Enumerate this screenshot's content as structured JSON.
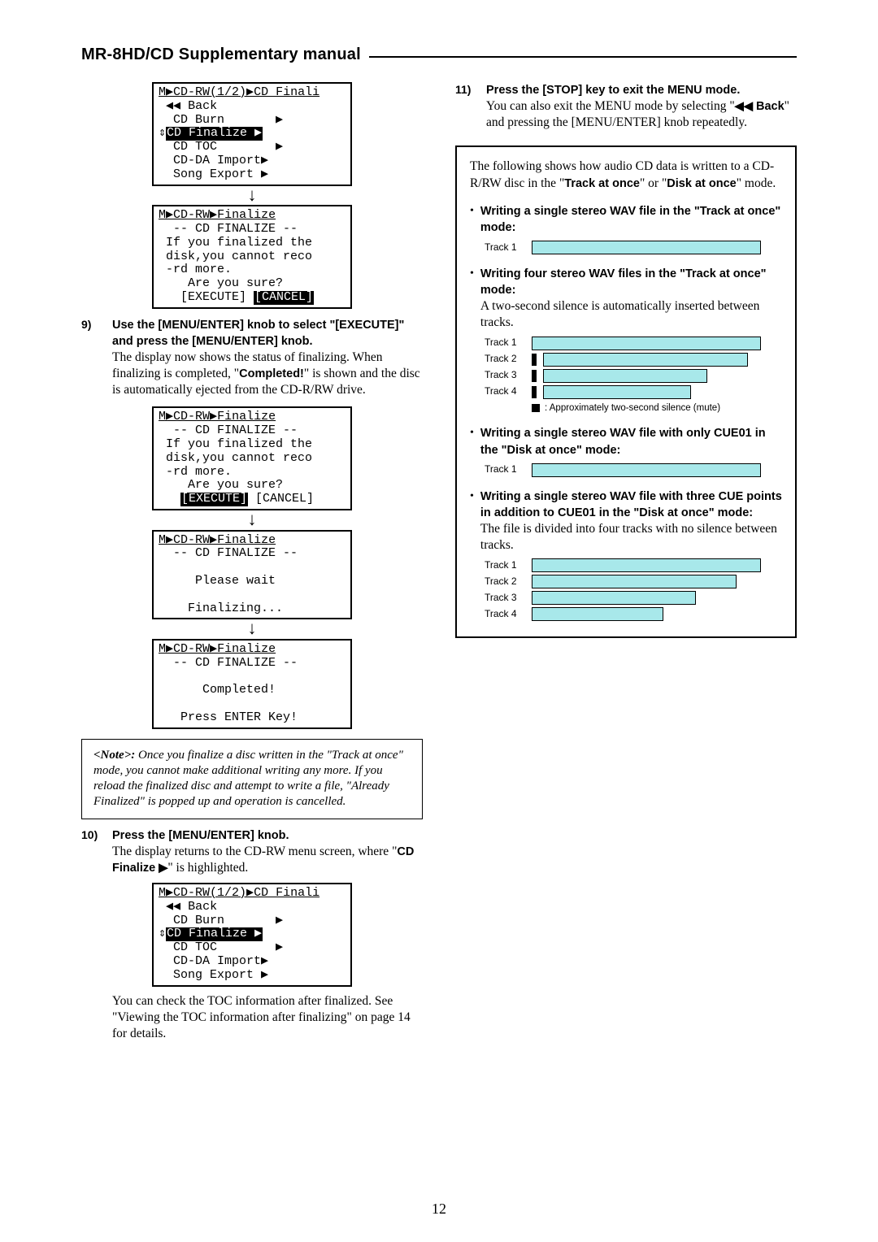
{
  "header": {
    "title": "MR-8HD/CD Supplementary manual"
  },
  "pageNumber": "12",
  "left": {
    "lcd1": {
      "breadcrumb": "M▶CD-RW(1/2)▶CD Finali",
      "back": " ◀◀ Back",
      "burn": "  CD Burn       ▶",
      "finalize": "CD Finalize ▶",
      "toc": "  CD TOC        ▶",
      "import": "  CD-DA Import▶",
      "export": "  Song Export ▶"
    },
    "lcd2": {
      "breadcrumb": "M▶CD-RW▶Finalize",
      "l1": "  -- CD FINALIZE --",
      "l2": " If you finalized the",
      "l3": " disk,you cannot reco",
      "l4": " -rd more.",
      "l5": "    Are you sure?",
      "exec": "[EXECUTE]",
      "cancel": "[CANCEL]"
    },
    "step9": {
      "num": "9)",
      "bold": "Use the [MENU/ENTER] knob to select \"[EXECUTE]\" and press the [MENU/ENTER] knob.",
      "p1": "The display now shows the status of finalizing. When finalizing is completed, \"",
      "p1b": "Completed!",
      "p1c": "\" is shown and the disc is automatically ejected from the CD-R/RW drive."
    },
    "lcd4": {
      "breadcrumb": "M▶CD-RW▶Finalize",
      "l1": "  -- CD FINALIZE --",
      "l2": " ",
      "l3": "     Please wait",
      "l4": " ",
      "l5": "    Finalizing..."
    },
    "lcd5": {
      "breadcrumb": "M▶CD-RW▶Finalize",
      "l1": "  -- CD FINALIZE --",
      "l2": " ",
      "l3": "      Completed!",
      "l4": " ",
      "l5": "   Press ENTER Key!"
    },
    "note": {
      "lead": "<Note>:",
      "body": " Once you finalize a disc written in the \"Track at once\" mode, you cannot make additional writing any more. If you reload the finalized disc and attempt to write a file, \"Already Finalized\" is popped up and operation is cancelled."
    },
    "step10": {
      "num": "10)",
      "bold": "Press the [MENU/ENTER] knob.",
      "p1": "The display returns to the CD-RW menu screen, where \"",
      "p1b": "CD Finalize ▶",
      "p1c": "\" is highlighted."
    },
    "tail": "You can check the TOC information after finalized. See \"Viewing the TOC information after finalizing\" on page 14 for details."
  },
  "right": {
    "step11": {
      "num": "11)",
      "bold": "Press the [STOP] key to exit the MENU mode.",
      "p1": "You can also exit the MENU mode by selecting \"",
      "p1b": "◀◀ Back",
      "p1c": "\" and pressing the [MENU/ENTER] knob repeatedly."
    },
    "boxIntro": {
      "a": "The following shows how audio CD data is written to a CD-R/RW disc in the \"",
      "b": "Track at once",
      "c": "\" or \"",
      "d": "Disk at once",
      "e": "\" mode."
    },
    "b1": "Writing a single stereo WAV file in the \"Track at once\" mode:",
    "b2": "Writing four stereo WAV files in the \"Track at once\" mode:",
    "b2p": "A two-second silence is automatically inserted between tracks.",
    "legend": ": Approximately two-second silence (mute)",
    "b3": "Writing a single stereo WAV file with only CUE01 in the \"Disk at once\" mode:",
    "b4": "Writing a single stereo WAV file with three CUE points in addition to CUE01 in the \"Disk at once\" mode:",
    "b4p": "The file is divided into four tracks with no silence between tracks.",
    "track": {
      "t1": "Track 1",
      "t2": "Track 2",
      "t3": "Track 3",
      "t4": "Track 4"
    }
  }
}
